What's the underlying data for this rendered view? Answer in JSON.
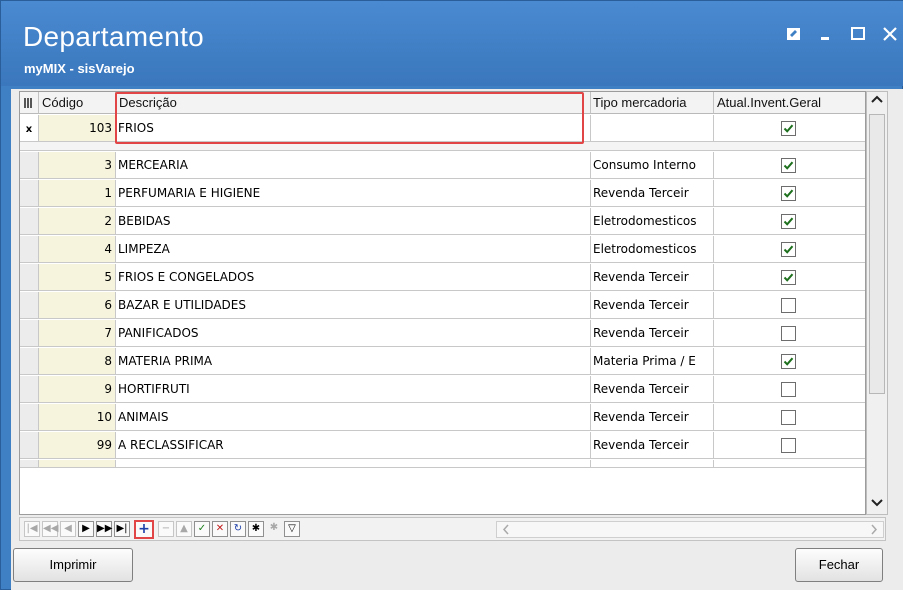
{
  "window": {
    "title": "Departamento",
    "subtitle": "myMIX - sisVarejo",
    "controls": [
      "restore-icon",
      "minimize-icon",
      "maximize-icon",
      "close-icon"
    ]
  },
  "grid": {
    "columns": {
      "indicator": "",
      "code": "Código",
      "description": "Descrição",
      "type": "Tipo mercadoria",
      "inventory": "Atual.Invent.Geral"
    },
    "filter_row": {
      "indicator": "x",
      "code": "103",
      "description": "FRIOS",
      "type": "",
      "inventory": true
    },
    "rows": [
      {
        "code": "3",
        "description": "MERCEARIA",
        "type": "Consumo Interno",
        "inventory": true
      },
      {
        "code": "1",
        "description": "PERFUMARIA E HIGIENE",
        "type": "Revenda Terceir",
        "inventory": true
      },
      {
        "code": "2",
        "description": "BEBIDAS",
        "type": "Eletrodomesticos",
        "inventory": true
      },
      {
        "code": "4",
        "description": "LIMPEZA",
        "type": "Eletrodomesticos",
        "inventory": true
      },
      {
        "code": "5",
        "description": "FRIOS E CONGELADOS",
        "type": "Revenda Terceir",
        "inventory": true
      },
      {
        "code": "6",
        "description": "BAZAR E UTILIDADES",
        "type": "Revenda Terceir",
        "inventory": false
      },
      {
        "code": "7",
        "description": "PANIFICADOS",
        "type": "Revenda Terceir",
        "inventory": false
      },
      {
        "code": "8",
        "description": "MATERIA PRIMA",
        "type": "Materia Prima / E",
        "inventory": true
      },
      {
        "code": "9",
        "description": "HORTIFRUTI",
        "type": "Revenda Terceir",
        "inventory": false
      },
      {
        "code": "10",
        "description": "ANIMAIS",
        "type": "Revenda Terceir",
        "inventory": false
      },
      {
        "code": "99",
        "description": "A RECLASSIFICAR",
        "type": "Revenda Terceir",
        "inventory": false
      }
    ]
  },
  "navigator": {
    "buttons": [
      "first-icon",
      "prior-page-icon",
      "prior-icon",
      "next-icon",
      "next-page-icon",
      "last-icon",
      "insert-icon",
      "delete-icon",
      "edit-icon",
      "post-icon",
      "cancel-icon",
      "refresh-icon",
      "apply-filter-icon",
      "clear-filter-icon",
      "filter-icon"
    ]
  },
  "buttons": {
    "print": "Imprimir",
    "close": "Fechar"
  },
  "colors": {
    "titlebar": "#3f7fc3",
    "highlight": "#e24545",
    "code_cell_bg": "#f6f4dd"
  }
}
